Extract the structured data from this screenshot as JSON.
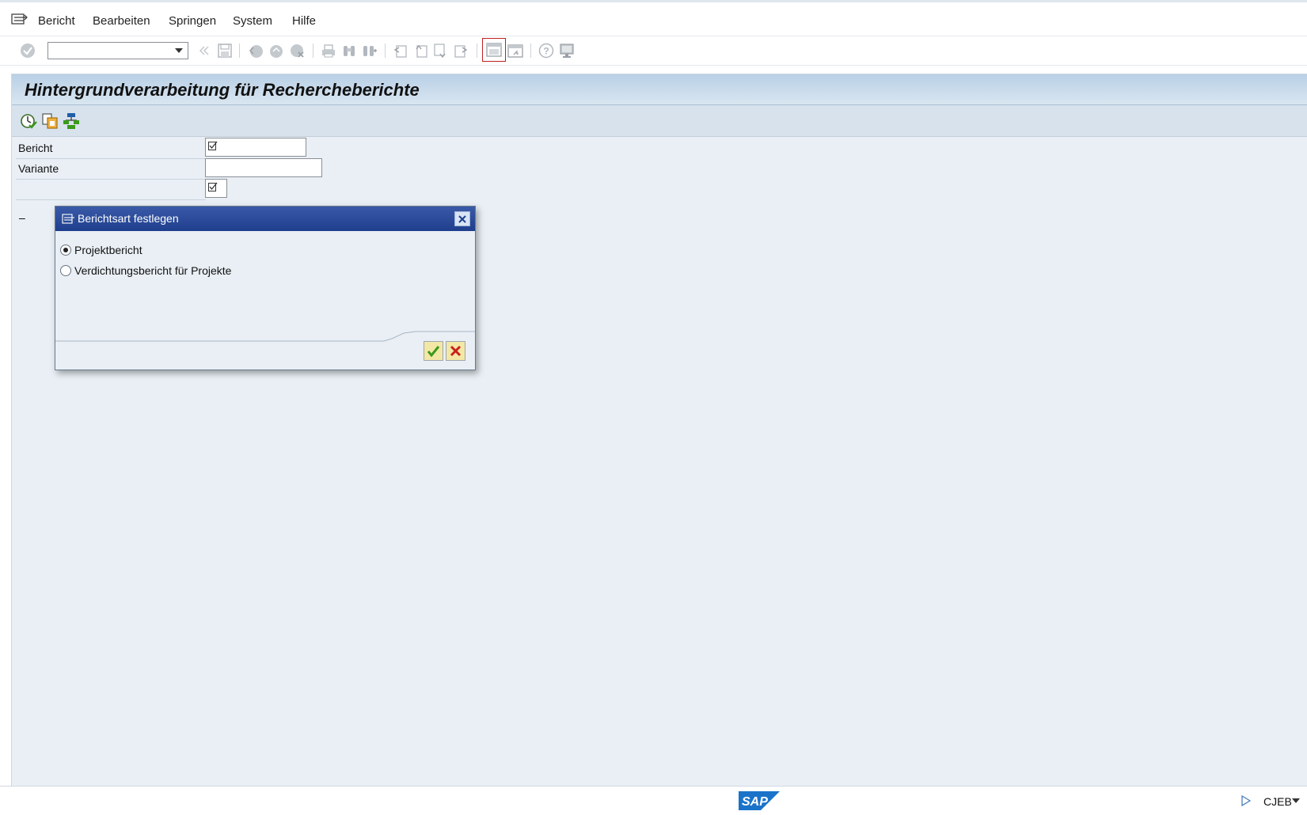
{
  "menubar": {
    "items": [
      {
        "label": "Bericht"
      },
      {
        "label": "Bearbeiten"
      },
      {
        "label": "Springen"
      },
      {
        "label": "System"
      },
      {
        "label": "Hilfe"
      }
    ]
  },
  "toolbar": {
    "command_value": ""
  },
  "page": {
    "title": "Hintergrundverarbeitung für Rechercheberichte"
  },
  "form": {
    "bericht_label": "Bericht",
    "variante_label": "Variante",
    "bericht_value": "",
    "variante_value": "",
    "dash": "–"
  },
  "dialog": {
    "title": "Berichtsart festlegen",
    "options": [
      {
        "label": "Projektbericht",
        "selected": true
      },
      {
        "label": "Verdichtungsbericht für Projekte",
        "selected": false
      }
    ]
  },
  "status": {
    "system": "CJEB",
    "logo": "SAP"
  },
  "colors": {
    "dialog_title": "#2a4a9c",
    "confirm": "#3a9a1a",
    "cancel": "#c8201a"
  }
}
